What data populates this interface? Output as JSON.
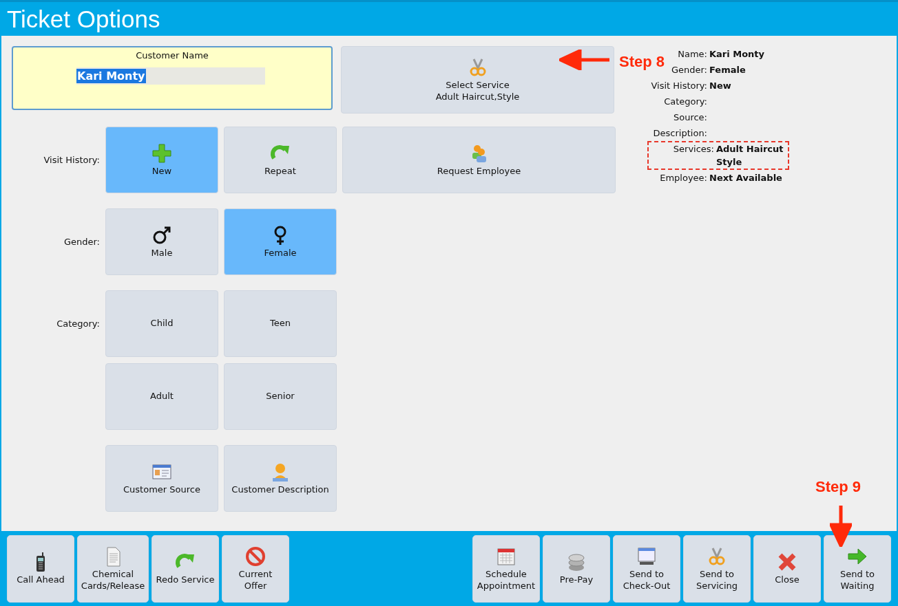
{
  "title": "Ticket Options",
  "customer_name": {
    "label": "Customer Name",
    "value": "Kari Monty",
    "selected": true
  },
  "select_service": {
    "title": "Select Service",
    "value": "Adult Haircut,Style"
  },
  "visit_history": {
    "label": "Visit History:",
    "options": [
      {
        "label": "New",
        "selected": true
      },
      {
        "label": "Repeat",
        "selected": false
      }
    ]
  },
  "request_employee": {
    "label": "Request Employee"
  },
  "gender": {
    "label": "Gender:",
    "options": [
      {
        "label": "Male",
        "selected": false
      },
      {
        "label": "Female",
        "selected": true
      }
    ]
  },
  "category": {
    "label": "Category:",
    "options": [
      {
        "label": "Child",
        "selected": false
      },
      {
        "label": "Teen",
        "selected": false
      },
      {
        "label": "Adult",
        "selected": false
      },
      {
        "label": "Senior",
        "selected": false
      }
    ]
  },
  "extras": [
    {
      "label": "Customer Source"
    },
    {
      "label": "Customer Description"
    }
  ],
  "summary": [
    {
      "label": "Name:",
      "value": "Kari Monty",
      "highlighted": false
    },
    {
      "label": "Gender:",
      "value": "Female",
      "highlighted": false
    },
    {
      "label": "Visit History:",
      "value": "New",
      "highlighted": false
    },
    {
      "label": "Category:",
      "highlighted": false
    },
    {
      "label": "Source:",
      "highlighted": false
    },
    {
      "label": "Description:",
      "highlighted": false
    },
    {
      "label": "Services:",
      "value": "Adult Haircut\nStyle",
      "highlighted": true
    },
    {
      "label": "Employee:",
      "value": "Next Available",
      "highlighted": false
    }
  ],
  "annotations": [
    {
      "text": "Step 8"
    },
    {
      "text": "Step 9"
    }
  ],
  "toolbar_left": [
    {
      "label": "Call Ahead"
    },
    {
      "label": "Chemical\nCards/Release"
    },
    {
      "label": "Redo Service"
    },
    {
      "label": "Current\nOffer"
    }
  ],
  "toolbar_right": [
    {
      "label": "Schedule\nAppointment"
    },
    {
      "label": "Pre-Pay"
    },
    {
      "label": "Send to\nCheck-Out"
    },
    {
      "label": "Send to\nServicing"
    },
    {
      "label": "Close"
    },
    {
      "label": "Send to\nWaiting"
    }
  ]
}
